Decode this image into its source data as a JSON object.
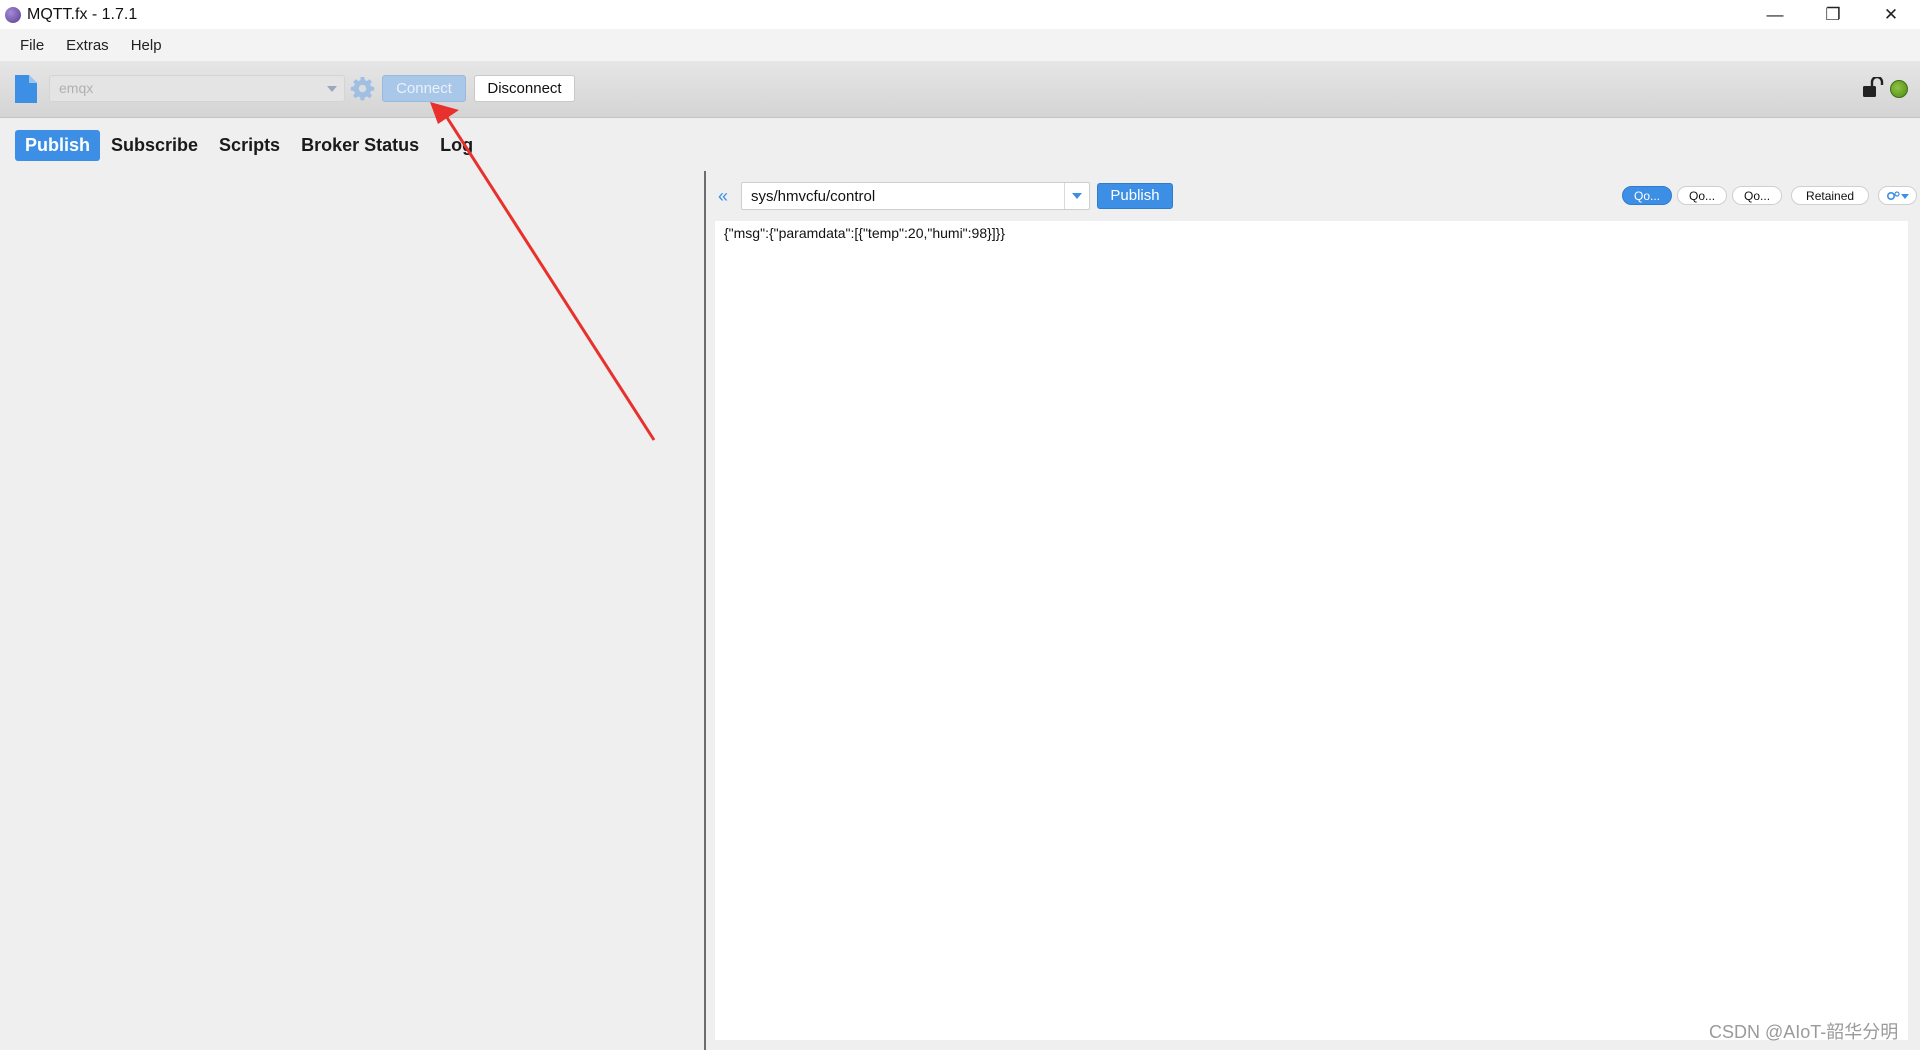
{
  "window": {
    "title": "MQTT.fx - 1.7.1",
    "controls": {
      "minimize": "—",
      "restore": "❐",
      "close": "✕"
    }
  },
  "menu": {
    "items": [
      "File",
      "Extras",
      "Help"
    ]
  },
  "toolbar": {
    "profile": "emqx",
    "connect_label": "Connect",
    "disconnect_label": "Disconnect",
    "connect_state": "disabled",
    "status_color": "#5a9a1f"
  },
  "tabs": {
    "items": [
      "Publish",
      "Subscribe",
      "Scripts",
      "Broker Status",
      "Log"
    ],
    "active": "Publish"
  },
  "publish": {
    "topic": "sys/hmvcfu/control",
    "publish_label": "Publish",
    "qos": [
      "Qo...",
      "Qo...",
      "Qo..."
    ],
    "qos_selected": 0,
    "retained_label": "Retained",
    "payload": "{\"msg\":{\"paramdata\":[{\"temp\":20,\"humi\":98}]}}"
  },
  "watermark": "CSDN @AIoT-韶华分明",
  "colors": {
    "accent": "#3d8fe5",
    "annotation_arrow": "#e8302c"
  }
}
